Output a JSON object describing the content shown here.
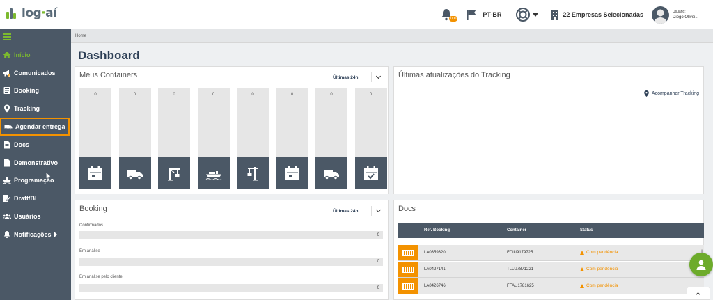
{
  "logo": {
    "text_main": "log",
    "text_dot": "·",
    "text_end": "aí"
  },
  "header": {
    "notification_badge": "000",
    "language": "PT-BR",
    "companies": "22 Empresas Selecionadas",
    "user_label": "Usuário:",
    "user_name": "Diogo Olivei..."
  },
  "sidebar": {
    "items": [
      {
        "label": "Início",
        "icon": "home-icon",
        "active": true
      },
      {
        "label": "Comunicados",
        "icon": "megaphone-icon",
        "badge": "1"
      },
      {
        "label": "Booking",
        "icon": "booking-icon"
      },
      {
        "label": "Tracking",
        "icon": "map-pin-icon"
      },
      {
        "label": "Agendar entrega",
        "icon": "truck-icon",
        "highlighted": true
      },
      {
        "label": "Docs",
        "icon": "document-icon"
      },
      {
        "label": "Demonstrativo",
        "icon": "file-icon"
      },
      {
        "label": "Programação",
        "icon": "ship-icon"
      },
      {
        "label": "Draft/BL",
        "icon": "draft-icon"
      },
      {
        "label": "Usuários",
        "icon": "users-icon"
      },
      {
        "label": "Notificações",
        "icon": "bell-icon",
        "has_arrow": true
      }
    ]
  },
  "breadcrumb": "Home",
  "page_title": "Dashboard",
  "containers_card": {
    "title": "Meus Containers",
    "range": "Últimas 24h",
    "columns": [
      {
        "value": "0",
        "icon": "calendar-icon"
      },
      {
        "value": "0",
        "icon": "truck-icon"
      },
      {
        "value": "0",
        "icon": "crane-icon"
      },
      {
        "value": "0",
        "icon": "ship-icon"
      },
      {
        "value": "0",
        "icon": "crane-lift-icon"
      },
      {
        "value": "0",
        "icon": "calendar-icon"
      },
      {
        "value": "0",
        "icon": "truck-icon"
      },
      {
        "value": "0",
        "icon": "calendar-check-icon"
      }
    ]
  },
  "tracking_card": {
    "title": "Últimas atualizações do Tracking",
    "link": "Acompanhar Tracking"
  },
  "booking_card": {
    "title": "Booking",
    "range": "Últimas 24h",
    "rows": [
      {
        "label": "Confirmados",
        "value": "0"
      },
      {
        "label": "Em análise",
        "value": "0"
      },
      {
        "label": "Em análise pelo cliente",
        "value": "0"
      }
    ]
  },
  "docs_card": {
    "title": "Docs",
    "headers": {
      "booking": "Ref. Booking",
      "container": "Container",
      "status": "Status"
    },
    "rows": [
      {
        "booking": "LA0359320",
        "container": "FCIU9179725",
        "status": "Com pendência",
        "trail": "|"
      },
      {
        "booking": "LA0427141",
        "container": "TLLU7871221",
        "status": "Com pendência",
        "trail": ""
      },
      {
        "booking": "LA0426746",
        "container": "FFAU1781625",
        "status": "Com pendência",
        "trail": ""
      }
    ]
  },
  "colors": {
    "accent_green": "#7cba2e",
    "sidebar": "#4b5866",
    "warning": "#f39200",
    "title": "#2c3e55"
  }
}
